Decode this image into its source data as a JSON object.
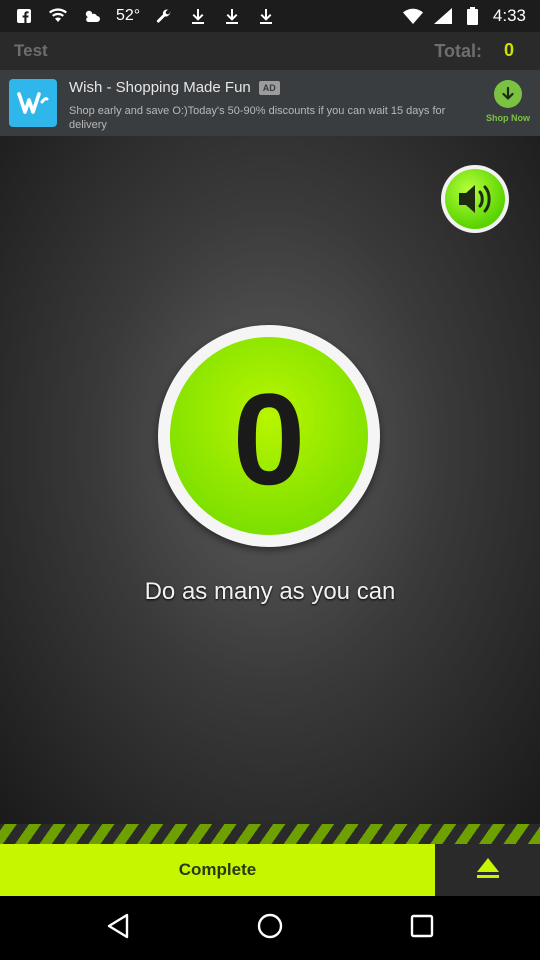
{
  "status_bar": {
    "signal_percent": "52°",
    "time": "4:33",
    "icons": [
      "facebook-icon",
      "wifi-icon",
      "weather-icon",
      "wrench-icon",
      "download-icon",
      "download-icon",
      "download-icon",
      "wifi-signal-icon",
      "cell-signal-icon",
      "battery-icon"
    ]
  },
  "header": {
    "title": "Test",
    "total_label": "Total:",
    "total_value": "0"
  },
  "ad": {
    "title": "Wish - Shopping Made Fun",
    "badge": "AD",
    "description": "Shop early and save O:)Today's 50-90% discounts if you can wait 15 days for delivery",
    "cta_label": "Shop Now",
    "brand_color": "#2fb7ec",
    "cta_color": "#7cc242"
  },
  "main": {
    "counter": "0",
    "instruction": "Do as many as you can",
    "accent_color": "#c7f700"
  },
  "bottom": {
    "complete_label": "Complete"
  }
}
